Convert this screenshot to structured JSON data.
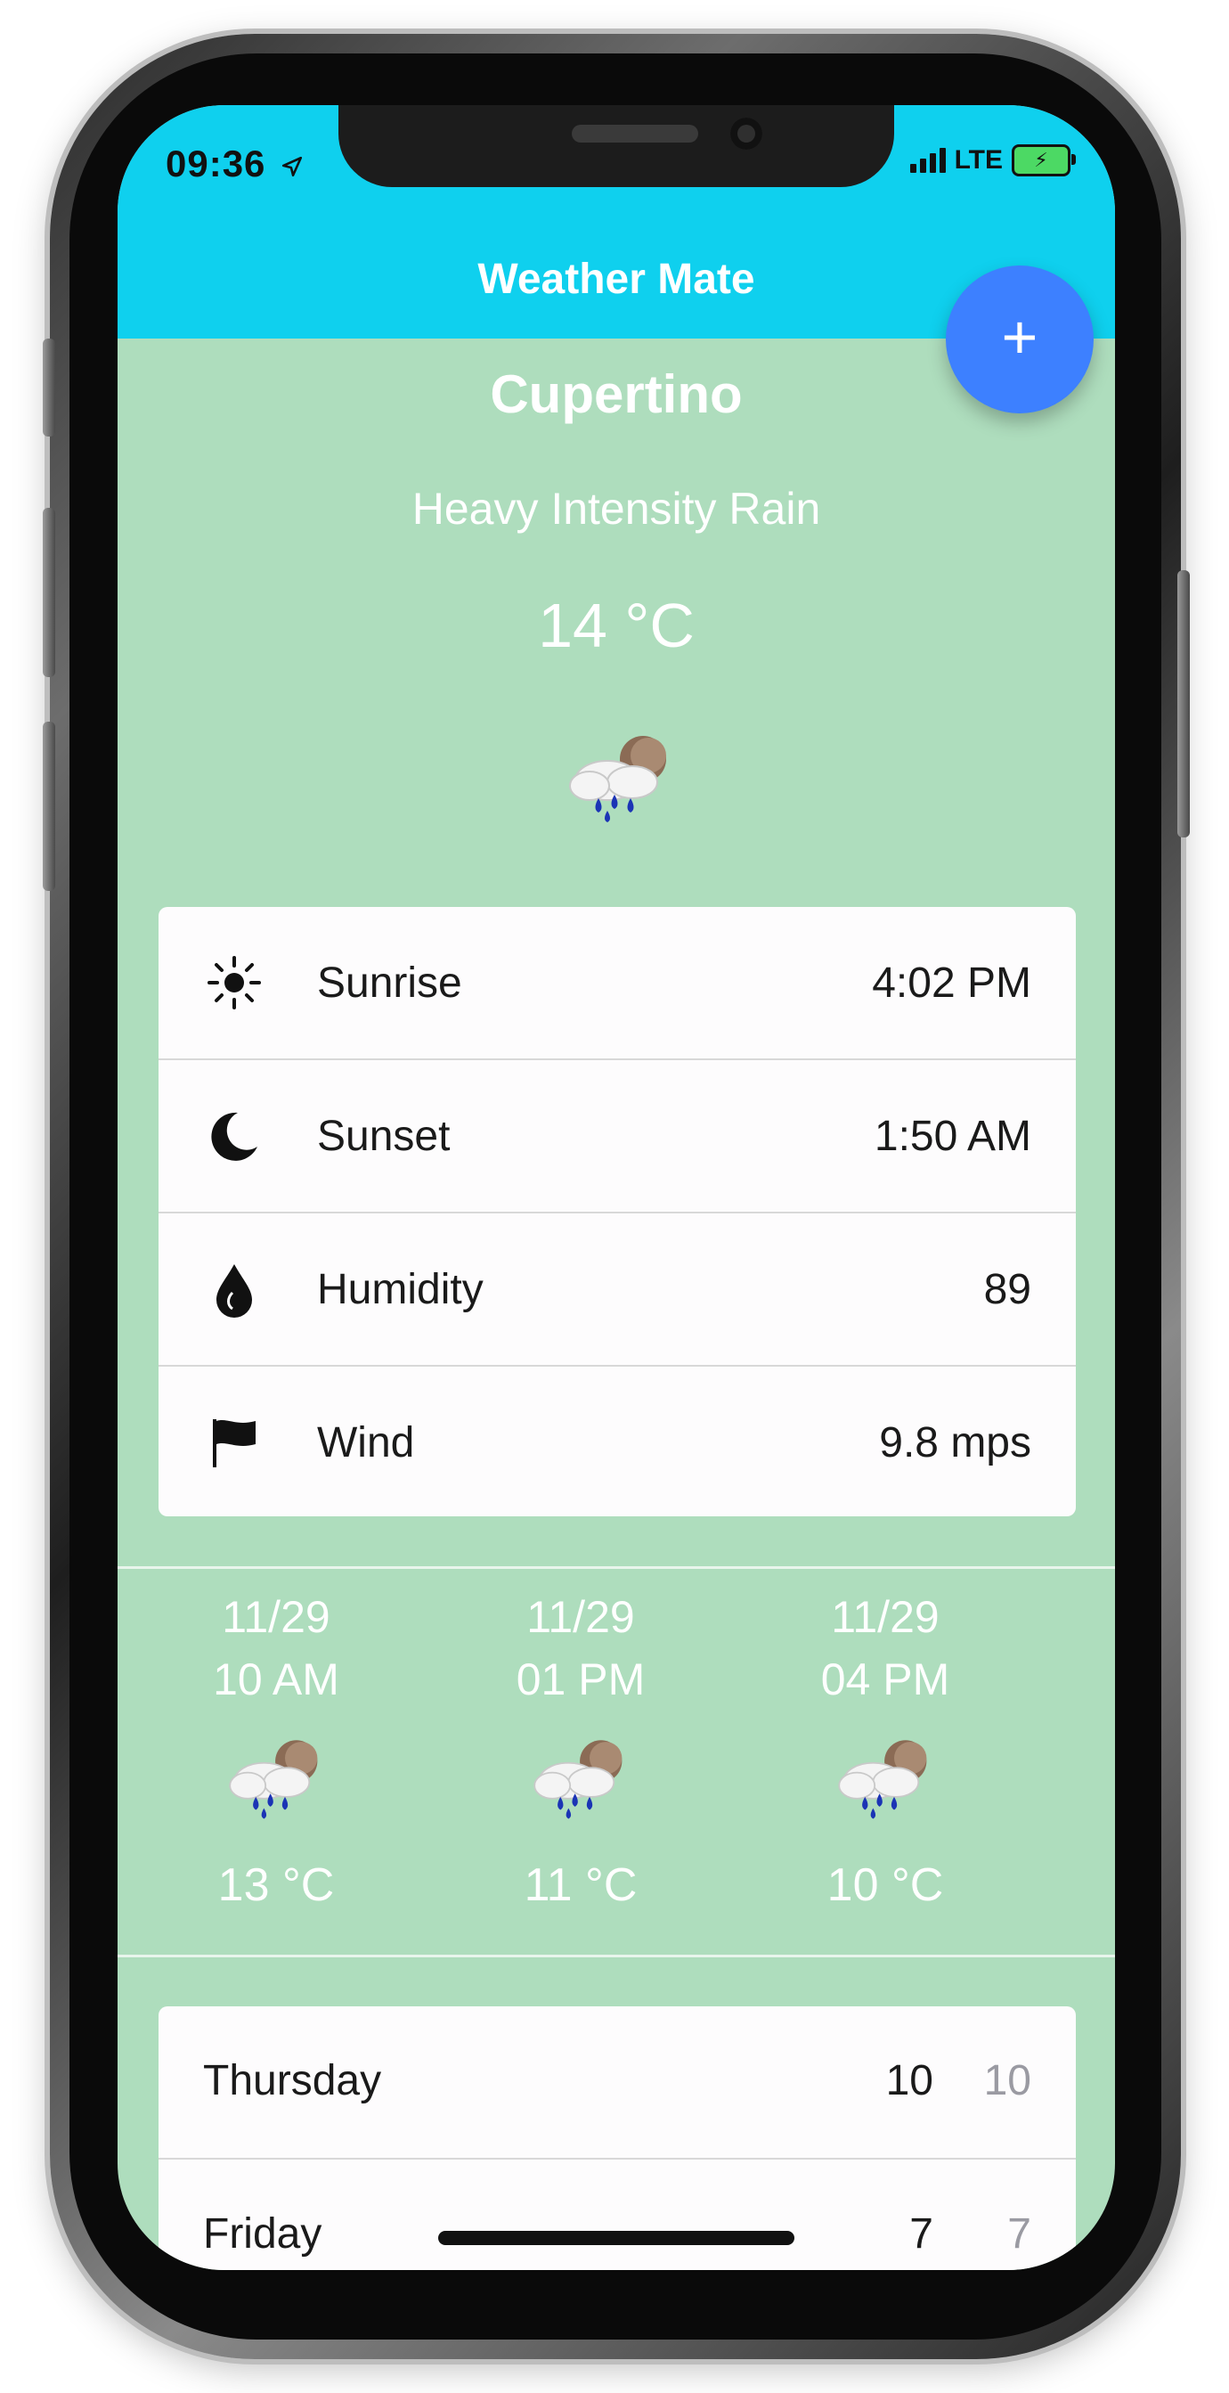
{
  "status_bar": {
    "time": "09:36",
    "network": "LTE"
  },
  "header": {
    "title": "Weather Mate",
    "add_label": "+"
  },
  "current": {
    "city": "Cupertino",
    "condition": "Heavy Intensity Rain",
    "temperature": "14 °C",
    "icon": "rain-cloud-icon"
  },
  "details": [
    {
      "icon": "sun-icon",
      "label": "Sunrise",
      "value": "4:02 PM"
    },
    {
      "icon": "moon-icon",
      "label": "Sunset",
      "value": "1:50 AM"
    },
    {
      "icon": "drop-icon",
      "label": "Humidity",
      "value": "89"
    },
    {
      "icon": "flag-icon",
      "label": "Wind",
      "value": "9.8 mps"
    }
  ],
  "hourly": [
    {
      "date": "11/29",
      "hour": "10 AM",
      "temp": "13 °C",
      "icon": "rain-cloud-icon"
    },
    {
      "date": "11/29",
      "hour": "01 PM",
      "temp": "11 °C",
      "icon": "rain-cloud-icon"
    },
    {
      "date": "11/29",
      "hour": "04 PM",
      "temp": "10 °C",
      "icon": "rain-cloud-icon"
    }
  ],
  "daily": [
    {
      "day": "Thursday",
      "high": "10",
      "low": "10"
    },
    {
      "day": "Friday",
      "high": "7",
      "low": "7"
    }
  ],
  "colors": {
    "header": "#0fd0ee",
    "background": "#aeddbd",
    "fab": "#3d80ff"
  }
}
